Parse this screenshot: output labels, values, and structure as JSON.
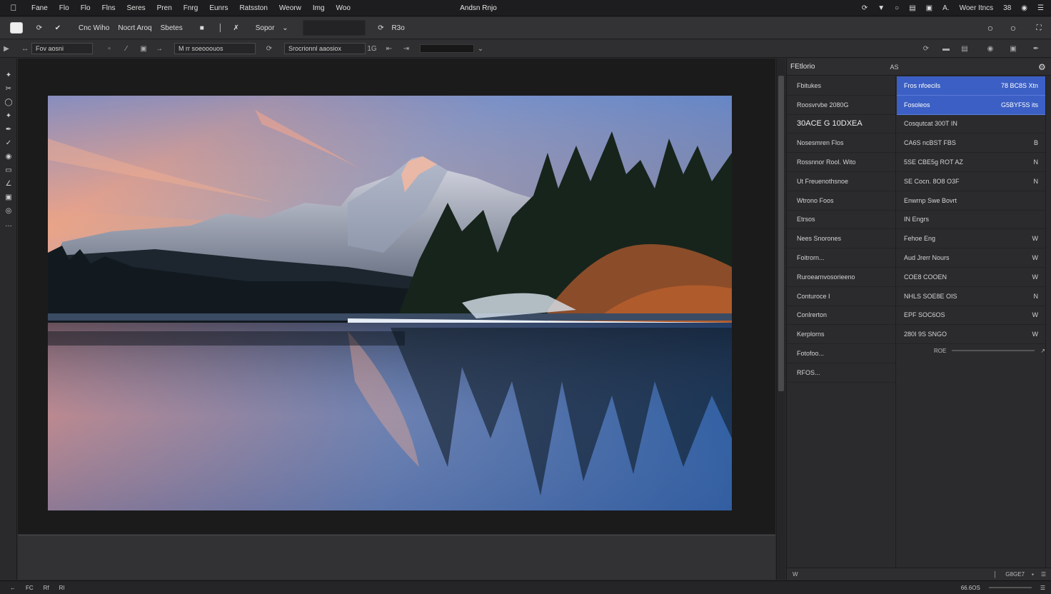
{
  "menubar": {
    "items": [
      "Fane",
      "Flo",
      "Flo",
      "Flns",
      "Seres",
      "Pren",
      "Fnrg",
      "Eunrs",
      "Ratsston",
      "Weorw",
      "Img",
      "Woo"
    ],
    "title": "Andsn Rnjo",
    "status": [
      "A.",
      "Woer Itncs",
      "38"
    ]
  },
  "toolbar": {
    "labels": [
      "Cnc Wiho",
      "Nocrt Aroq",
      "Sbetes",
      "Sopor",
      "R3o"
    ]
  },
  "optbar": {
    "fields": [
      "Fov aosni",
      "M rr soeooouos",
      "Srocrionnl aaosiox"
    ],
    "num": "1G"
  },
  "panel": {
    "title": "FEtlorio",
    "subtitle": "AS",
    "left_rows": [
      "Fbitukes",
      "Roosvrvbe 2080G",
      "30ACE G  10DXEA",
      "Nosesmren Flos",
      "Rossnnor Rool. Wito",
      "Ut Freuenothsnoe",
      "Wtrono Foos",
      "Etrsos",
      "Nees Snorones",
      "Foitrorn...",
      "Ruroearnvosorieeno",
      "Conturoce  I",
      "Conlrerton",
      "Kerplorns",
      "Fotofoo...",
      "RFOS..."
    ],
    "right_rows": [
      {
        "label": "Fros nfoecils",
        "value": "78 BC8S  Xtn"
      },
      {
        "label": "Fosoleos",
        "value": "G5BYF5S  its"
      },
      {
        "label": "Cosqutcat 300T IN",
        "value": ""
      },
      {
        "label": "CA6S ncBST FBS",
        "value": "B"
      },
      {
        "label": "5SE CBE5g  ROT AZ",
        "value": "N"
      },
      {
        "label": "SE Cocn. 8O8 O3F",
        "value": "N"
      },
      {
        "label": "Enwrnp  Swe Bovrt",
        "value": ""
      },
      {
        "label": "IN  Engrs",
        "value": ""
      },
      {
        "label": "Fehoe Eng",
        "value": "W"
      },
      {
        "label": "Aud Jrerr Nours",
        "value": "W"
      },
      {
        "label": "COE8 COOEN",
        "value": "W"
      },
      {
        "label": "NHLS  SOE8E OIS",
        "value": "N"
      },
      {
        "label": "EPF  SOC6OS",
        "value": "W"
      },
      {
        "label": "280I  9S  SNGO",
        "value": "W"
      }
    ],
    "slider_label": "ROE",
    "footer_left": "W",
    "footer_value": "G8GE7"
  },
  "statusbar": {
    "left": [
      "FC",
      "Rf",
      "Rl"
    ],
    "zoom": "66.6OS"
  }
}
